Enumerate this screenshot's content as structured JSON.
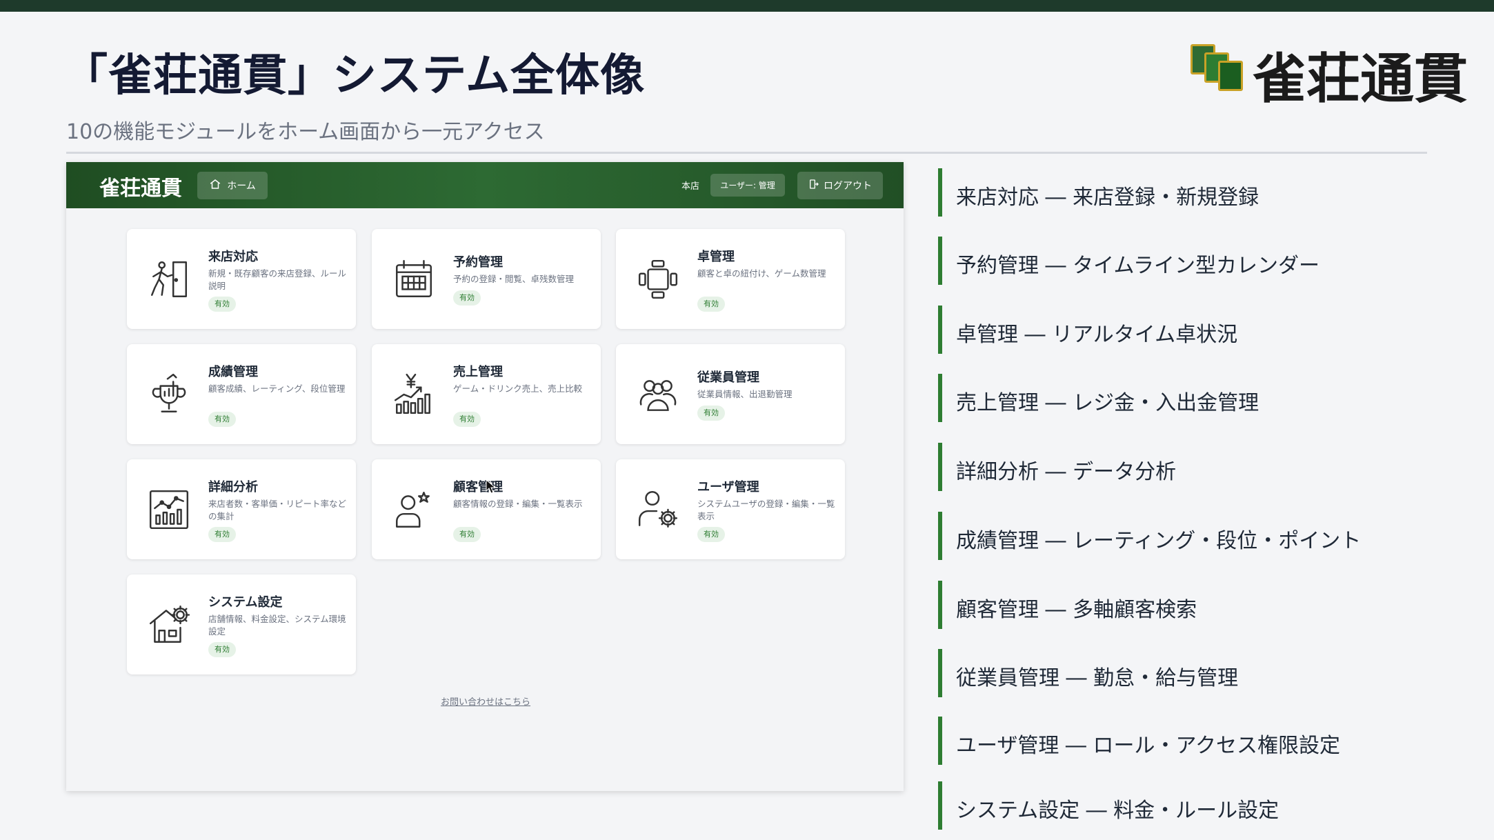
{
  "slide": {
    "title": "「雀荘通貫」システム全体像",
    "subtitle": "10の機能モジュールをホーム画面から一元アクセス",
    "logo_text": "雀荘通貫"
  },
  "app": {
    "header": {
      "logo": "雀荘通貫",
      "home_label": "ホーム",
      "store": "本店",
      "user": "ユーザー: 管理",
      "logout_label": "ログアウト"
    },
    "cards": [
      {
        "title": "来店対応",
        "desc": "新規・既存顧客の来店登録、ルール説明",
        "badge": "有効",
        "icon": "door-walk-icon"
      },
      {
        "title": "予約管理",
        "desc": "予約の登録・閲覧、卓残数管理",
        "badge": "有効",
        "icon": "calendar-icon"
      },
      {
        "title": "卓管理",
        "desc": "顧客と卓の紐付け、ゲーム数管理",
        "badge": "有効",
        "icon": "table-icon"
      },
      {
        "title": "成績管理",
        "desc": "顧客成績、レーティング、段位管理",
        "badge": "有効",
        "icon": "trophy-icon"
      },
      {
        "title": "売上管理",
        "desc": "ゲーム・ドリンク売上、売上比較",
        "badge": "有効",
        "icon": "yen-chart-icon"
      },
      {
        "title": "従業員管理",
        "desc": "従業員情報、出退勤管理",
        "badge": "有効",
        "icon": "staff-group-icon"
      },
      {
        "title": "詳細分析",
        "desc": "来店者数・客単価・リピート率などの集計",
        "badge": "有効",
        "icon": "analytics-icon"
      },
      {
        "title": "顧客管理",
        "desc": "顧客情報の登録・編集・一覧表示",
        "badge": "有効",
        "icon": "customer-star-icon"
      },
      {
        "title": "ユーザ管理",
        "desc": "システムユーザの登録・編集・一覧表示",
        "badge": "有効",
        "icon": "user-gear-icon"
      },
      {
        "title": "システム設定",
        "desc": "店舗情報、料金設定、システム環境設定",
        "badge": "有効",
        "icon": "house-gear-icon"
      }
    ],
    "contact_link": "お問い合わせはこちら"
  },
  "features": [
    "来店対応 ― 来店登録・新規登録",
    "予約管理 ― タイムライン型カレンダー",
    "卓管理 ― リアルタイム卓状況",
    "売上管理 ― レジ金・入出金管理",
    "詳細分析 ― データ分析",
    "成績管理 ― レーティング・段位・ポイント",
    "顧客管理 ― 多軸顧客検索",
    "従業員管理 ― 勤怠・給与管理",
    "ユーザ管理 ― ロール・アクセス権限設定",
    "システム設定 ― 料金・ルール設定"
  ],
  "colors": {
    "top_bar": "#1e3a2b",
    "header_green": "#2d6a33",
    "accent_green": "#2e7d32",
    "badge_bg": "#e6f2e7",
    "title_navy": "#141a33"
  }
}
